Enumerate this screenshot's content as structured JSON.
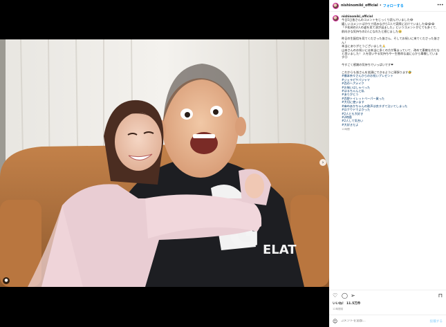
{
  "post": {
    "username": "nishinomiki_official",
    "follow_label": "フォローする",
    "more_icon": "more-dots-icon"
  },
  "caption": {
    "username": "nishinomiki_official",
    "lines": [
      "今日1日皆さんのコメントをじっくり読んでいました😂",
      "嬉しいコメントばかりで読みながら1人で実際に泣けていました😭😭😭",
      "「チ松岡の2人の姿を見て涙が出ました」というコメントがとても多くて、前向きな気持ちの2人になれたと感じました🥹",
      "",
      "昨日の生配信を見てくださった皆さん、そしてお祝いに来てくださった皆さん！",
      "本当にありがとうございました🙏",
      "山本さんのお祝いには本当に多くの方が集まっていて、改めて素敵な方だなと思いました！ 人を思いやる気持ちや一生懸命な姿に心から尊敬しています😊",
      "",
      "今すごく感謝の気持ちでいっぱいです❤",
      "",
      "これからも皆さんを笑顔にできるように頑張ります🤣"
    ],
    "hashtags": [
      "#橋本奈々さんからのお祝いプレゼント",
      "#ジェラピケパジャマ",
      "#西のヘアメイク",
      "#お揃いはしゃべった",
      "#はるちゃんと私",
      "#ありがとう",
      "#西野トイレットペーパー買った",
      "#大切に使います",
      "#麻布あかちゃんの歌声は良すぎて泣いてしまった",
      "#ロナウドでよかった",
      "#2人とも大好き",
      "#2時間",
      "#2人して気合い",
      "#大好きだよ"
    ],
    "time": "12時間"
  },
  "actions": {
    "like_icon": "heart-icon",
    "comment_icon": "comment-icon",
    "share_icon": "share-icon",
    "bookmark_icon": "bookmark-icon",
    "likes_text": "いいね！ 11.5万件",
    "date_text": "12時間前"
  },
  "comment_box": {
    "placeholder": "コメントを追加...",
    "post_label": "投稿する"
  },
  "colors": {
    "link": "#00376b",
    "follow": "#0095f6",
    "text": "#262626",
    "muted": "#8e8e8e"
  }
}
